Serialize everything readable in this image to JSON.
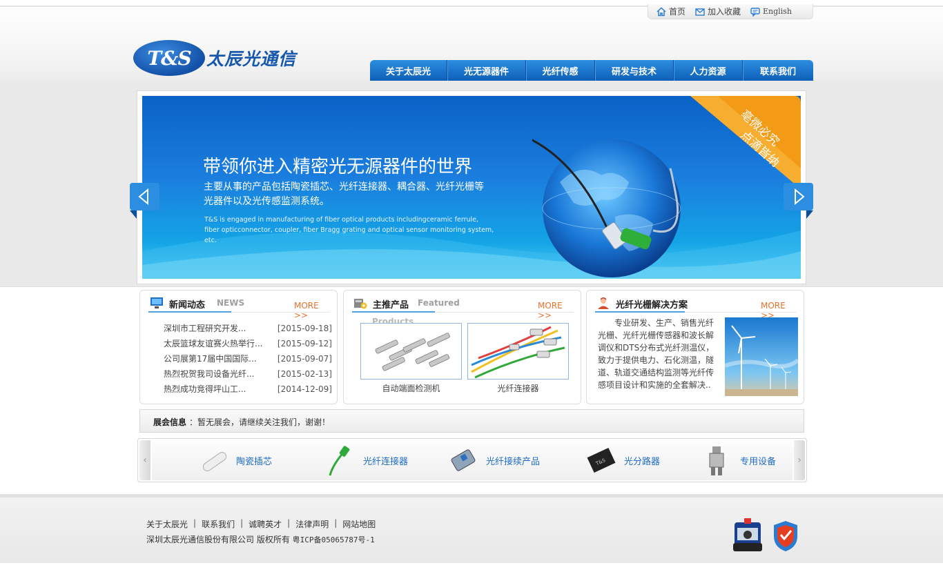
{
  "top_links": [
    {
      "label": "首页",
      "icon": "home-icon"
    },
    {
      "label": "加入收藏",
      "icon": "envelope-icon"
    },
    {
      "label": "English",
      "icon": "chat-icon"
    }
  ],
  "logo": {
    "mark": "T&S",
    "name": "太辰光通信"
  },
  "nav": [
    {
      "label": "关于太辰光"
    },
    {
      "label": "光无源器件"
    },
    {
      "label": "光纤传感"
    },
    {
      "label": "研发与技术"
    },
    {
      "label": "人力资源"
    },
    {
      "label": "联系我们"
    }
  ],
  "banner": {
    "title": "带领你进入精密光无源器件的世界",
    "subtitle": "主要从事的产品包括陶瓷插芯、光纤连接器、耦合器、光纤光栅等光器件以及光传感监测系统。",
    "english": "T&S is engaged in manufacturing of fiber optical products includingceramic ferrule, fiber opticconnector, coupler, fiber Bragg grating and optical sensor monitoring system, etc.",
    "ribbon_line1": "亳微必究",
    "ribbon_line2": "点滴皆纳"
  },
  "news": {
    "title": "新闻动态",
    "subtitle": "NEWS",
    "more": "MORE >>",
    "items": [
      {
        "title": "深圳市工程研究开发...",
        "date": "[2015-09-18]"
      },
      {
        "title": "太辰篮球友谊赛火热举行...",
        "date": "[2015-09-12]"
      },
      {
        "title": "公司展第17届中国国际...",
        "date": "[2015-09-07]"
      },
      {
        "title": "热烈祝贺我司设备光纤...",
        "date": "[2015-02-13]"
      },
      {
        "title": "热烈成功竞得坪山工...",
        "date": "[2014-12-09]"
      }
    ]
  },
  "products": {
    "title": "主推产品",
    "subtitle": "Featured",
    "subtitle2": "Products",
    "more": "MORE >>",
    "items": [
      {
        "caption": "自动端面检测机"
      },
      {
        "caption": "光纤连接器"
      }
    ]
  },
  "solutions": {
    "title": "光纤光栅解决方案",
    "more": "MORE >>",
    "text": "专业研发、生产、销售光纤光栅、光纤光栅传感器和波长解调仪和DTS分布式光纤测温仪，致力于提供电力、石化测温，隧道、轨道交通结构监测等光纤传感项目设计和实施的全套解决.."
  },
  "expo": {
    "label": "展会信息",
    "text": "：暂无展会，请继续关注我们，谢谢！"
  },
  "carousel": [
    {
      "label": "陶瓷插芯",
      "icon": "ferrule-icon"
    },
    {
      "label": "光纤连接器",
      "icon": "connector-icon"
    },
    {
      "label": "光纤接续产品",
      "icon": "adapter-icon"
    },
    {
      "label": "光分路器",
      "icon": "splitter-icon"
    },
    {
      "label": "专用设备",
      "icon": "equipment-icon"
    }
  ],
  "footer": {
    "links": [
      "关于太辰光",
      "联系我们",
      "诚聘英才",
      "法律声明",
      "网站地图"
    ],
    "copyright": "深圳太辰光通信股份有限公司 版权所有 ",
    "icp": "粤ICP备05065787号-1"
  },
  "colors": {
    "brand_blue": "#0d5fb8",
    "more_orange": "#e8702a"
  }
}
